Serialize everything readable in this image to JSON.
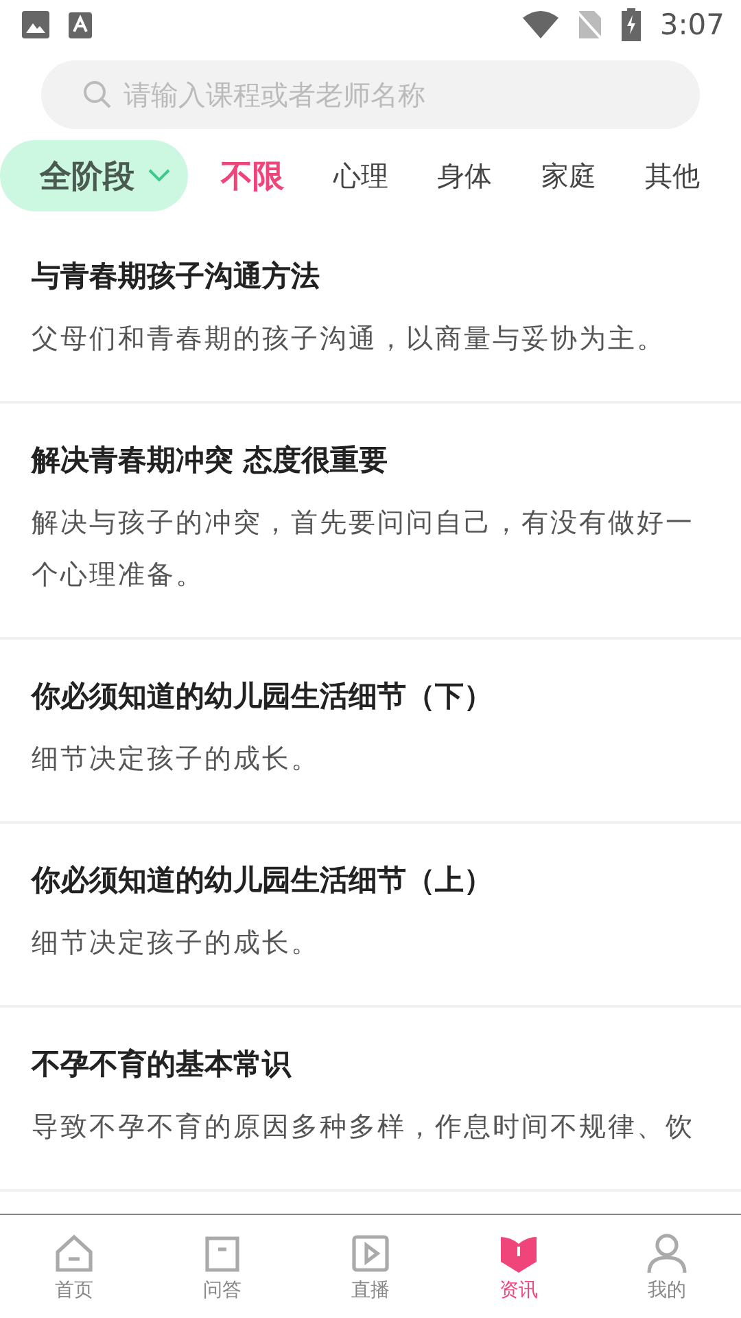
{
  "status_bar": {
    "time": "3:07"
  },
  "search": {
    "placeholder": "请输入课程或者老师名称"
  },
  "stage_filter": {
    "label": "全阶段"
  },
  "categories": [
    {
      "label": "不限",
      "selected": true
    },
    {
      "label": "心理",
      "selected": false
    },
    {
      "label": "身体",
      "selected": false
    },
    {
      "label": "家庭",
      "selected": false
    },
    {
      "label": "其他",
      "selected": false
    }
  ],
  "articles": [
    {
      "title": "与青春期孩子沟通方法",
      "summary": "父母们和青春期的孩子沟通，以商量与妥协为主。"
    },
    {
      "title": "解决青春期冲突 态度很重要",
      "summary": "解决与孩子的冲突，首先要问问自己，有没有做好一个心理准备。"
    },
    {
      "title": "你必须知道的幼儿园生活细节（下）",
      "summary": "细节决定孩子的成长。"
    },
    {
      "title": "你必须知道的幼儿园生活细节（上）",
      "summary": "细节决定孩子的成长。"
    },
    {
      "title": "不孕不育的基本常识",
      "summary": "导致不孕不育的原因多种多样，作息时间不规律、饮"
    }
  ],
  "bottom_nav": [
    {
      "kind": "home",
      "label": "首页",
      "selected": false
    },
    {
      "kind": "qa",
      "label": "问答",
      "selected": false
    },
    {
      "kind": "live",
      "label": "直播",
      "selected": false
    },
    {
      "kind": "news",
      "label": "资讯",
      "selected": true
    },
    {
      "kind": "me",
      "label": "我的",
      "selected": false
    }
  ]
}
